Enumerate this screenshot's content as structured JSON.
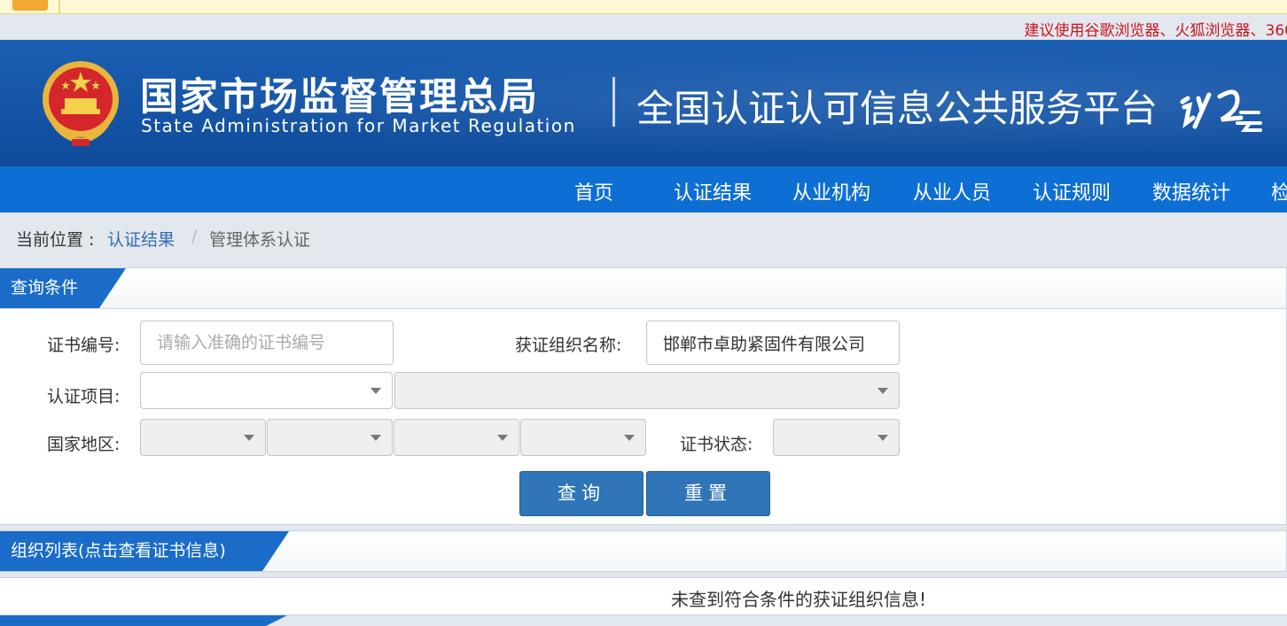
{
  "notice": {
    "text": "建议使用谷歌浏览器、火狐浏览器、360"
  },
  "header": {
    "agency_cn": "国家市场监督管理总局",
    "agency_en": "State Administration  for  Market Regulation",
    "platform": "全国认证认可信息公共服务平台",
    "logo_text": "认云"
  },
  "nav": {
    "items": [
      "首页",
      "认证结果",
      "从业机构",
      "从业人员",
      "认证规则",
      "数据统计",
      "检"
    ]
  },
  "breadcrumb": {
    "prefix": "当前位置 : ",
    "level1": "认证结果",
    "separator": "/",
    "level2": "管理体系认证"
  },
  "query": {
    "title": "查询条件",
    "cert_no_label": "证书编号:",
    "cert_no_placeholder": "请输入准确的证书编号",
    "org_label": "获证组织名称:",
    "org_value": "邯郸市卓助紧固件有限公司",
    "project_label": "认证项目:",
    "region_label": "国家地区:",
    "status_label": "证书状态:",
    "search_button": "查询",
    "reset_button": "重置"
  },
  "org_list": {
    "title": "组织列表(点击查看证书信息)",
    "empty_message": "未查到符合条件的获证组织信息!"
  },
  "colors": {
    "banner_blue": "#1454a6",
    "nav_blue": "#0d6fd3",
    "tab_blue": "#1a6cc8",
    "button_blue": "#2f75b7",
    "notice_red": "#c8161d",
    "link_blue": "#2f6fb3"
  }
}
